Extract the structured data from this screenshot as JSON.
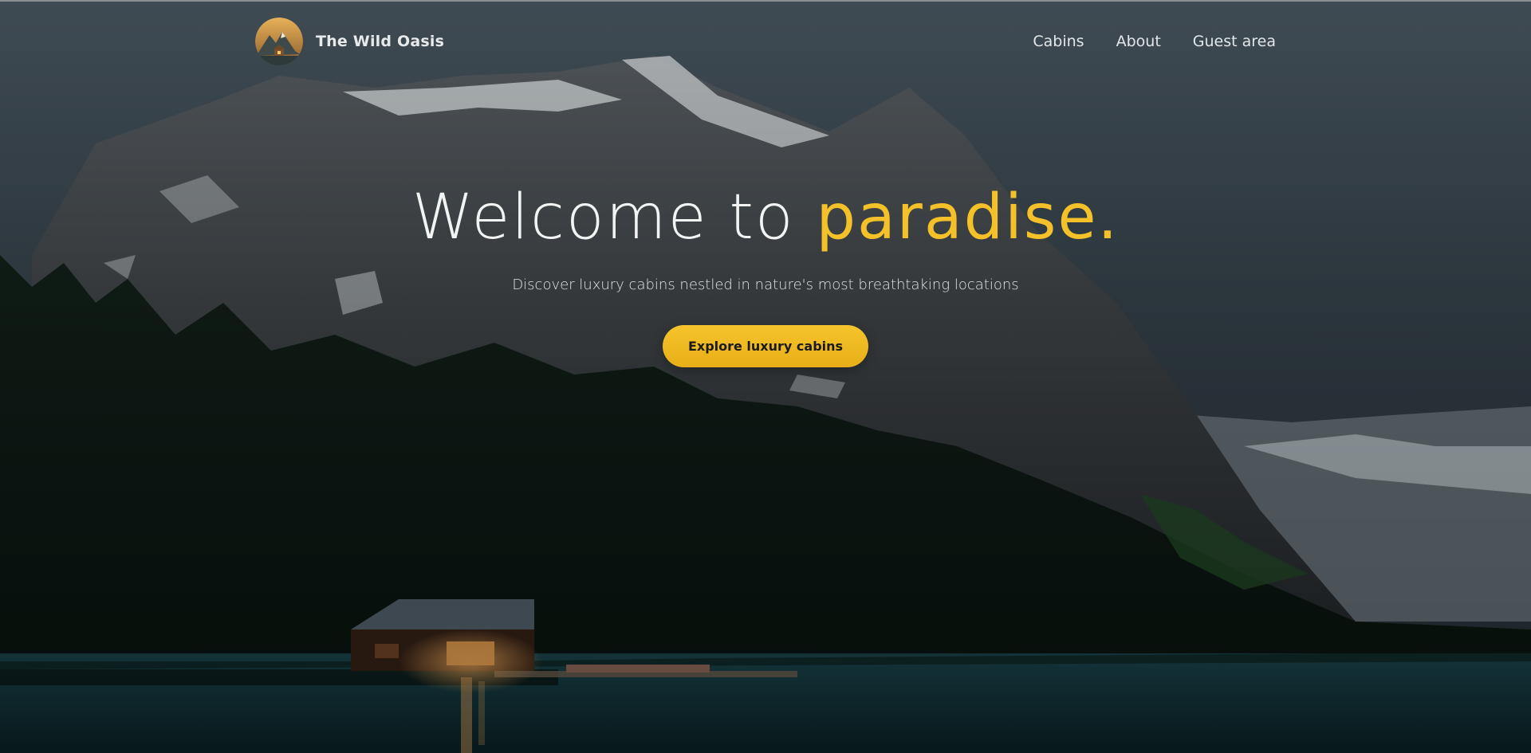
{
  "brand": {
    "name": "The Wild Oasis",
    "logo_icon": "mountain-cabin-logo-icon"
  },
  "nav": {
    "items": [
      {
        "label": "Cabins"
      },
      {
        "label": "About"
      },
      {
        "label": "Guest area"
      }
    ]
  },
  "hero": {
    "headline_prefix": "Welcome to ",
    "headline_accent": "paradise.",
    "subtitle": "Discover luxury cabins nestled in nature's most breathtaking locations",
    "cta_label": "Explore luxury cabins",
    "background": "mountain-lake-cabin-photo"
  },
  "colors": {
    "accent": "#f4c12b",
    "button": "#f2bb24",
    "text_light": "#f2f3f3"
  }
}
